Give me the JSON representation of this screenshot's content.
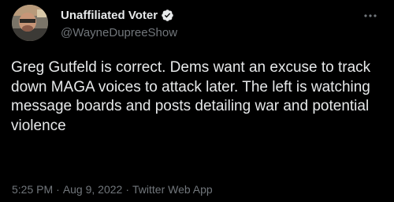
{
  "author": {
    "display_name": "Unaffiliated Voter",
    "handle": "@WayneDupreeShow",
    "verified": true,
    "avatar_icon": "profile-photo"
  },
  "more_menu_icon": "more-horizontal-icon",
  "tweet": {
    "text": "Greg Gutfeld is correct. Dems want an excuse to track down MAGA voices to attack later. The left is watching message boards and posts detailing war and potential violence"
  },
  "meta": {
    "time": "5:25 PM",
    "separator": "·",
    "date": "Aug 9, 2022",
    "source": "Twitter Web App"
  },
  "colors": {
    "background": "#000000",
    "primary_text": "#e7e9ea",
    "secondary_text": "#71767b",
    "verified_badge": "#e7e9ea"
  }
}
